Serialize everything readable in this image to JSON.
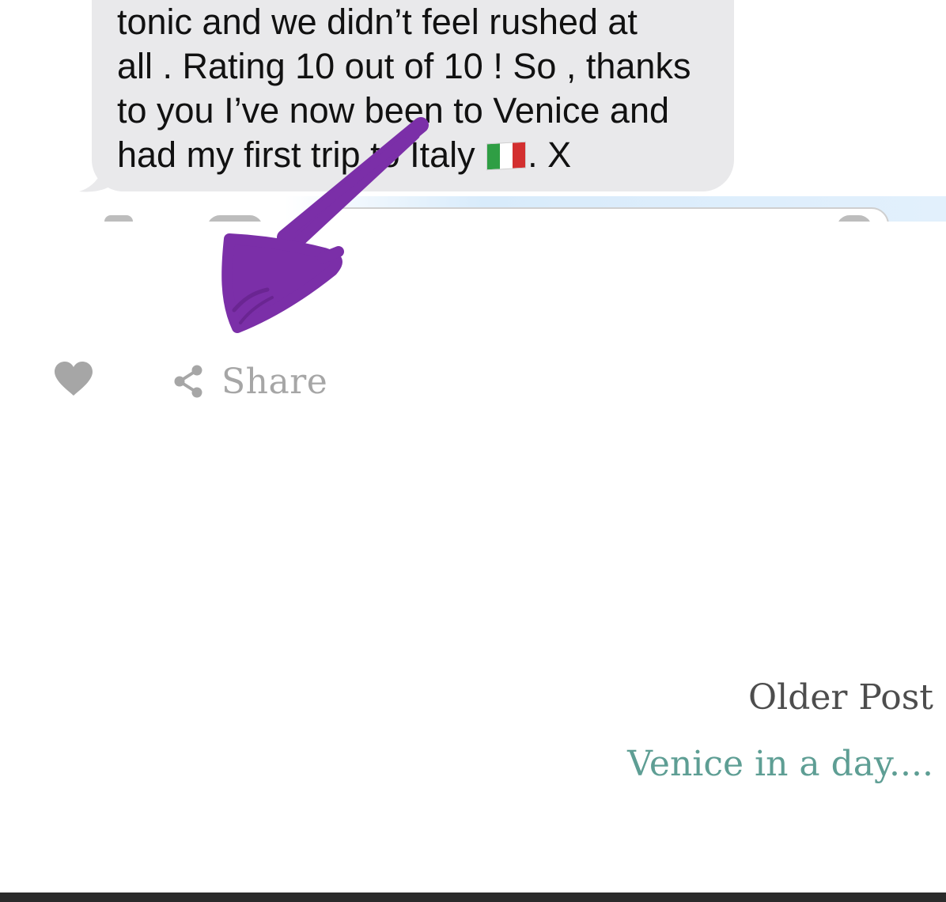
{
  "message": {
    "lines": [
      "tonic and we didn’t feel rushed at",
      "all . Rating 10 out of 10 ! So , thanks",
      "to you I’ve now been to Venice and",
      "had my first trip to Italy"
    ],
    "line_end": ". X",
    "emoji": "italy-flag-emoji",
    "bubble_color": "#e9e9eb"
  },
  "annotation": {
    "type": "hand-drawn-arrow",
    "color": "#7b2fa8"
  },
  "actions": {
    "like_icon": "heart-icon",
    "share_icon": "share-icon",
    "share_label": "Share",
    "icon_color": "#a6a6a6"
  },
  "pagination": {
    "older_label": "Older Post",
    "older_title": "Venice in a day....",
    "link_color": "#5e9e94"
  },
  "footer": {
    "color": "#2b2b2b"
  }
}
